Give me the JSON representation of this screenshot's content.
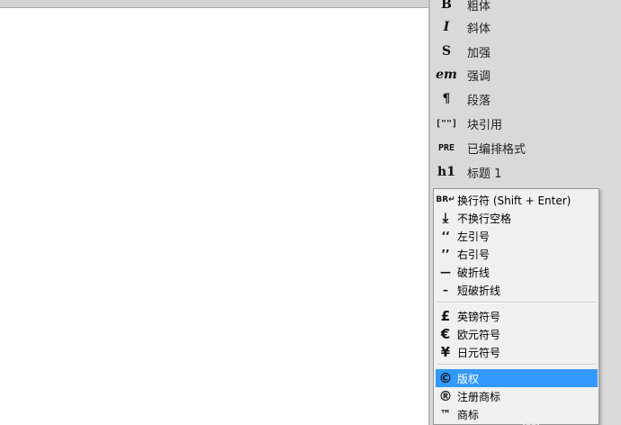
{
  "format_panel": {
    "items": [
      {
        "icon": "B",
        "label": "粗体"
      },
      {
        "icon": "I",
        "label": "斜体"
      },
      {
        "icon": "S",
        "label": "加强"
      },
      {
        "icon": "em",
        "label": "强调"
      },
      {
        "icon": "¶",
        "label": "段落"
      },
      {
        "icon": "[\"\"]",
        "label": "块引用"
      },
      {
        "icon": "PRE",
        "label": "已编排格式"
      },
      {
        "icon": "h1",
        "label": "标题 1"
      }
    ]
  },
  "special_chars_menu": {
    "items": [
      {
        "icon": "BR↵",
        "label": "换行符 (Shift + Enter)"
      },
      {
        "icon": "⤓",
        "label": "不换行空格"
      },
      {
        "icon": "‘‘",
        "label": "左引号"
      },
      {
        "icon": "’’",
        "label": "右引号"
      },
      {
        "icon": "—",
        "label": "破折线"
      },
      {
        "icon": "–",
        "label": "短破折线"
      },
      {
        "icon": "£",
        "label": "英镑符号"
      },
      {
        "icon": "€",
        "label": "欧元符号"
      },
      {
        "icon": "¥",
        "label": "日元符号"
      },
      {
        "icon": "©",
        "label": "版权"
      },
      {
        "icon": "®",
        "label": "注册商标"
      },
      {
        "icon": "™",
        "label": "商标"
      }
    ],
    "highlighted_item": "版权"
  }
}
